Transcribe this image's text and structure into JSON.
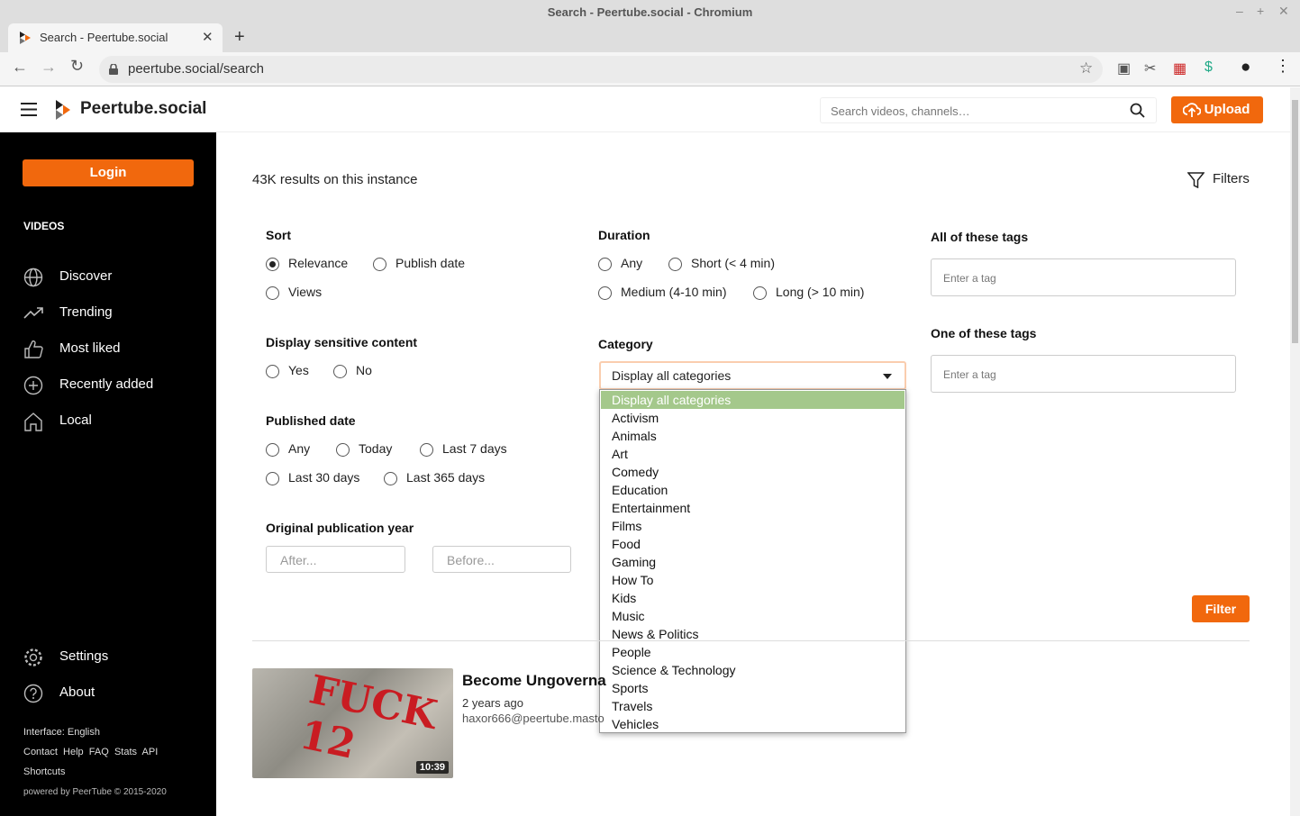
{
  "window": {
    "title": "Search - Peertube.social - Chromium"
  },
  "browser": {
    "tab_title": "Search - Peertube.social",
    "url": "peertube.social/search"
  },
  "header": {
    "brand": "Peertube.social",
    "search_placeholder": "Search videos, channels…",
    "upload_label": "Upload"
  },
  "sidebar": {
    "login_label": "Login",
    "videos_heading": "VIDEOS",
    "items": [
      {
        "label": "Discover",
        "icon": "globe-icon"
      },
      {
        "label": "Trending",
        "icon": "trending-icon"
      },
      {
        "label": "Most liked",
        "icon": "thumbs-up-icon"
      },
      {
        "label": "Recently added",
        "icon": "plus-circle-icon"
      },
      {
        "label": "Local",
        "icon": "home-icon"
      }
    ],
    "settings_label": "Settings",
    "about_label": "About",
    "interface_lang": "Interface: English",
    "links": [
      "Contact",
      "Help",
      "FAQ",
      "Stats",
      "API"
    ],
    "shortcuts": "Shortcuts",
    "powered": "powered by PeerTube © 2015-2020"
  },
  "main": {
    "results_text": "43K results on this instance",
    "filters_label": "Filters",
    "sort": {
      "label": "Sort",
      "options": [
        "Relevance",
        "Publish date",
        "Views"
      ],
      "selected": "Relevance"
    },
    "sensitive": {
      "label": "Display sensitive content",
      "options": [
        "Yes",
        "No"
      ]
    },
    "published": {
      "label": "Published date",
      "options": [
        "Any",
        "Today",
        "Last 7 days",
        "Last 30 days",
        "Last 365 days"
      ]
    },
    "orig_year": {
      "label": "Original publication year",
      "after_placeholder": "After...",
      "before_placeholder": "Before..."
    },
    "duration": {
      "label": "Duration",
      "options": [
        "Any",
        "Short (< 4 min)",
        "Medium (4-10 min)",
        "Long (> 10 min)"
      ]
    },
    "category": {
      "label": "Category",
      "selected": "Display all categories",
      "options": [
        "Display all categories",
        "Activism",
        "Animals",
        "Art",
        "Comedy",
        "Education",
        "Entertainment",
        "Films",
        "Food",
        "Gaming",
        "How To",
        "Kids",
        "Music",
        "News & Politics",
        "People",
        "Science & Technology",
        "Sports",
        "Travels",
        "Vehicles"
      ]
    },
    "all_tags": {
      "label": "All of these tags",
      "placeholder": "Enter a tag"
    },
    "one_tags": {
      "label": "One of these tags",
      "placeholder": "Enter a tag"
    },
    "filter_button": "Filter",
    "video": {
      "title": "Become Ungoverna",
      "date": "2 years ago",
      "account": "haxor666@peertube.masto",
      "duration": "10:39",
      "thumb_text": "FUCK 12"
    }
  },
  "colors": {
    "accent": "#f1680d",
    "sidebar_bg": "#000000",
    "selected_option": "#a4c88b"
  }
}
